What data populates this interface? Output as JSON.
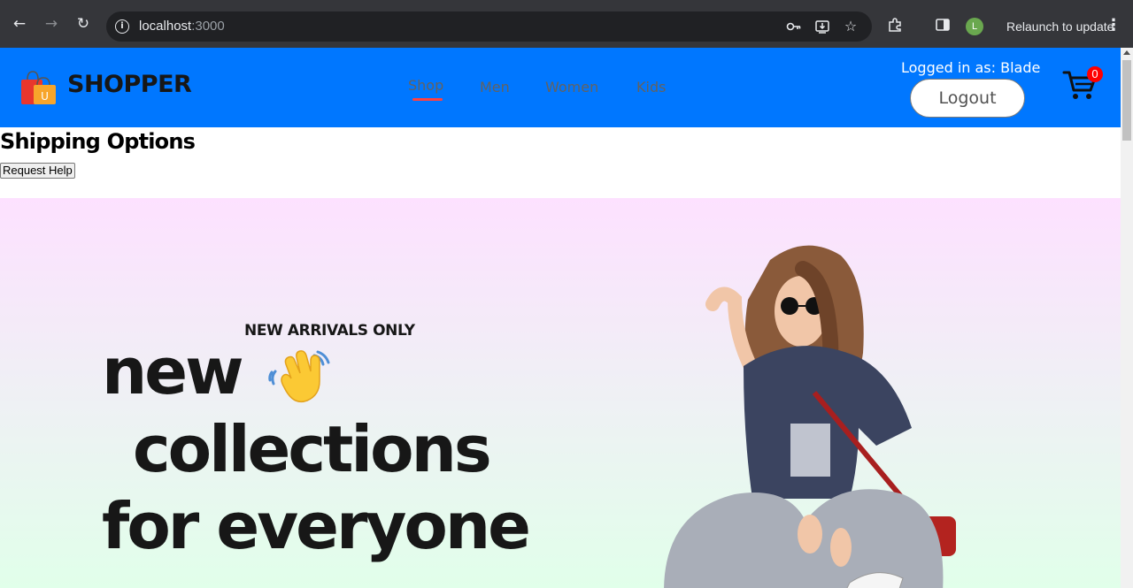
{
  "browser": {
    "url_host": "localhost",
    "url_port": ":3000",
    "relaunch_label": "Relaunch to update",
    "profile_initial": "L"
  },
  "navbar": {
    "brand": "SHOPPER",
    "logo_letter": "U",
    "menu": [
      {
        "label": "Shop",
        "active": true
      },
      {
        "label": "Men",
        "active": false
      },
      {
        "label": "Women",
        "active": false
      },
      {
        "label": "Kids",
        "active": false
      }
    ],
    "login_status": "Logged in as: Blade",
    "logout_label": "Logout",
    "cart_count": "0"
  },
  "shipping": {
    "title": "Shipping Options",
    "help_label": "Request Help"
  },
  "hero": {
    "kicker": "NEW ARRIVALS ONLY",
    "line1": "new",
    "line2": "collections",
    "line3": "for everyone"
  },
  "colors": {
    "navbar_bg": "#0077ff",
    "accent_underline": "#ff4141",
    "cart_badge": "#ff0000",
    "hero_gradient_top": "#fde1ff",
    "hero_gradient_bottom": "#e1ffea"
  }
}
